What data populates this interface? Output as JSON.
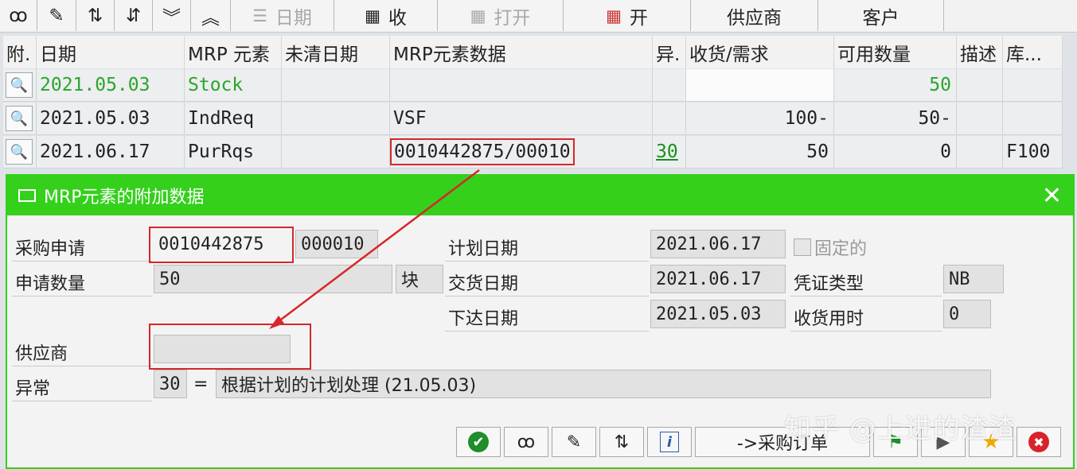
{
  "toolbar": {
    "buttons": [
      {
        "label": "",
        "icon": "glasses-icon"
      },
      {
        "label": "",
        "icon": "pencil-icon"
      },
      {
        "label": "",
        "icon": "hierarchy-up-icon"
      },
      {
        "label": "",
        "icon": "hierarchy-down-icon"
      },
      {
        "label": "",
        "icon": "double-chevron-down-icon"
      },
      {
        "label": "",
        "icon": "double-chevron-up-icon"
      },
      {
        "label": "日期",
        "icon": "lines-icon"
      },
      {
        "label": "收",
        "icon": "calendar-icon"
      },
      {
        "label": "打开",
        "icon": "calendar-icon"
      },
      {
        "label": "开",
        "icon": "calendar-flag-icon"
      },
      {
        "label": "供应商",
        "icon": ""
      },
      {
        "label": "客户",
        "icon": ""
      }
    ]
  },
  "table": {
    "columns": [
      "附.",
      "日期",
      "MRP 元素",
      "未清日期",
      "MRP元素数据",
      "异.",
      "收货/需求",
      "可用数量",
      "描述",
      "库..."
    ],
    "rows": [
      {
        "date": "2021.05.03",
        "element": "Stock",
        "open_date": "",
        "data": "",
        "exc": "",
        "receipt": "",
        "avail": "50",
        "desc": "",
        "store": ""
      },
      {
        "date": "2021.05.03",
        "element": "IndReq",
        "open_date": "",
        "data": "VSF",
        "exc": "",
        "receipt": "100-",
        "avail": "50-",
        "desc": "",
        "store": ""
      },
      {
        "date": "2021.06.17",
        "element": "PurRqs",
        "open_date": "",
        "data": "0010442875/00010",
        "exc": "30",
        "receipt": "50",
        "avail": "0",
        "desc": "",
        "store": "F100"
      }
    ]
  },
  "dialog": {
    "title": "MRP元素的附加数据",
    "fields": {
      "pr_label": "采购申请",
      "pr_number": "0010442875",
      "pr_item": "000010",
      "qty_label": "申请数量",
      "qty_value": "50",
      "unit": "块",
      "vendor_label": "供应商",
      "vendor_value": "",
      "exception_label": "异常",
      "exception_code": "30",
      "exception_eq": "=",
      "exception_text": "根据计划的计划处理 (21.05.03)",
      "plan_date_label": "计划日期",
      "plan_date": "2021.06.17",
      "fixed_label": "固定的",
      "delivery_date_label": "交货日期",
      "delivery_date": "2021.06.17",
      "doc_type_label": "凭证类型",
      "doc_type": "NB",
      "release_date_label": "下达日期",
      "release_date": "2021.05.03",
      "gr_time_label": "收货用时",
      "gr_time": "0"
    },
    "buttons": {
      "to_po": "->采购订单"
    }
  },
  "watermark": "知乎 @上进的渣渣",
  "colors": {
    "dialog_green": "#35d01c",
    "stock_green": "#2aa52a",
    "highlight_red": "#d7262a"
  }
}
